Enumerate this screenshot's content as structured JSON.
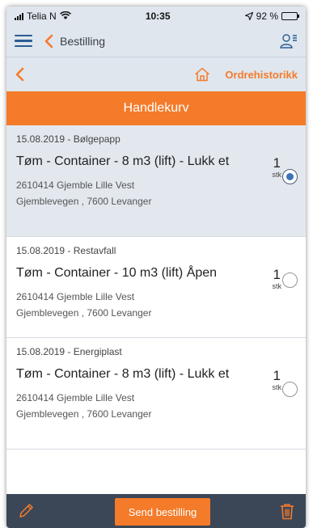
{
  "status": {
    "carrier": "Telia N",
    "time": "10:35",
    "battery_text": "92 %",
    "battery_level": 0.92
  },
  "nav": {
    "title": "Bestilling",
    "icons": [
      "menu-icon",
      "back-chevron-icon",
      "user-list-icon"
    ]
  },
  "subheader": {
    "history_link": "Ordrehistorikk",
    "icons": [
      "back-chevron-icon",
      "home-icon"
    ]
  },
  "banner": {
    "title": "Handlekurv"
  },
  "items": [
    {
      "date": "15.08.2019 - Bølgepapp",
      "title": "Tøm - Container - 8 m3 (lift) - Lukk et",
      "address_line1": "2610414 Gjemble Lille Vest",
      "address_line2": "Gjemblevegen , 7600 Levanger",
      "qty": "1",
      "unit": "stk",
      "selected": true
    },
    {
      "date": "15.08.2019 - Restavfall",
      "title": "Tøm - Container - 10 m3 (lift) Åpen",
      "address_line1": "2610414 Gjemble Lille Vest",
      "address_line2": "Gjemblevegen , 7600 Levanger",
      "qty": "1",
      "unit": "stk",
      "selected": false
    },
    {
      "date": "15.08.2019 - Energiplast",
      "title": "Tøm - Container - 8 m3 (lift) - Lukk et",
      "address_line1": "2610414 Gjemble Lille Vest",
      "address_line2": "Gjemblevegen , 7600 Levanger",
      "qty": "1",
      "unit": "stk",
      "selected": false
    }
  ],
  "bottom": {
    "send_label": "Send bestilling",
    "icons": [
      "edit-pencil-icon",
      "trash-icon"
    ]
  },
  "colors": {
    "accent": "#f47b2a",
    "header_bg": "#dfe6ee",
    "bottom_bg": "#3b4657",
    "nav_blue": "#2a5d93",
    "radio_checked": "#3e73b8"
  }
}
